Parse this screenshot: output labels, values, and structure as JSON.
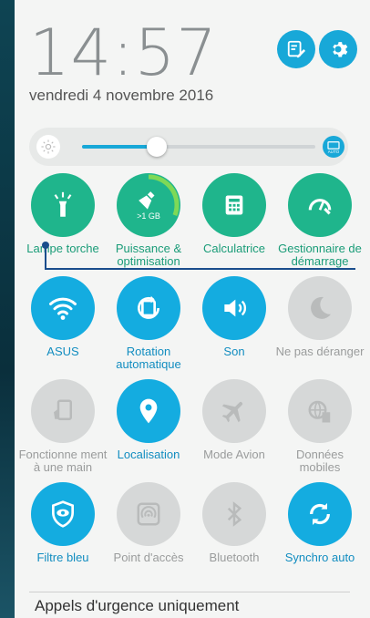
{
  "header": {
    "time": "14:57",
    "date": "vendredi 4 novembre 2016"
  },
  "brightness": {
    "level": 0.32,
    "auto_label": "AUTO"
  },
  "tiles": [
    {
      "label": "Lampe torche",
      "icon": "flashlight-icon",
      "state": "on-green"
    },
    {
      "label": "Puissance & optimisation",
      "icon": "broom-icon",
      "badge": ">1 GB",
      "state": "on-green"
    },
    {
      "label": "Calculatrice",
      "icon": "calculator-icon",
      "state": "on-green"
    },
    {
      "label": "Gestionnaire de démarrage",
      "icon": "speedometer-icon",
      "state": "on-green"
    },
    {
      "label": "ASUS",
      "icon": "wifi-icon",
      "state": "on-blue"
    },
    {
      "label": "Rotation automatique",
      "icon": "rotation-icon",
      "state": "on-blue"
    },
    {
      "label": "Son",
      "icon": "speaker-icon",
      "state": "on-blue"
    },
    {
      "label": "Ne pas déranger",
      "icon": "moon-icon",
      "state": "off"
    },
    {
      "label": "Fonctionne ment à une main",
      "icon": "one-hand-icon",
      "state": "off"
    },
    {
      "label": "Localisation",
      "icon": "location-pin-icon",
      "state": "on-blue"
    },
    {
      "label": "Mode Avion",
      "icon": "airplane-icon",
      "state": "off"
    },
    {
      "label": "Données mobiles",
      "icon": "mobile-data-icon",
      "state": "off"
    },
    {
      "label": "Filtre bleu",
      "icon": "eye-shield-icon",
      "state": "on-blue"
    },
    {
      "label": "Point d'accès",
      "icon": "hotspot-icon",
      "state": "off"
    },
    {
      "label": "Bluetooth",
      "icon": "bluetooth-icon",
      "state": "off"
    },
    {
      "label": "Synchro auto",
      "icon": "sync-icon",
      "state": "on-blue"
    }
  ],
  "footer": {
    "text": "Appels d'urgence uniquement"
  }
}
